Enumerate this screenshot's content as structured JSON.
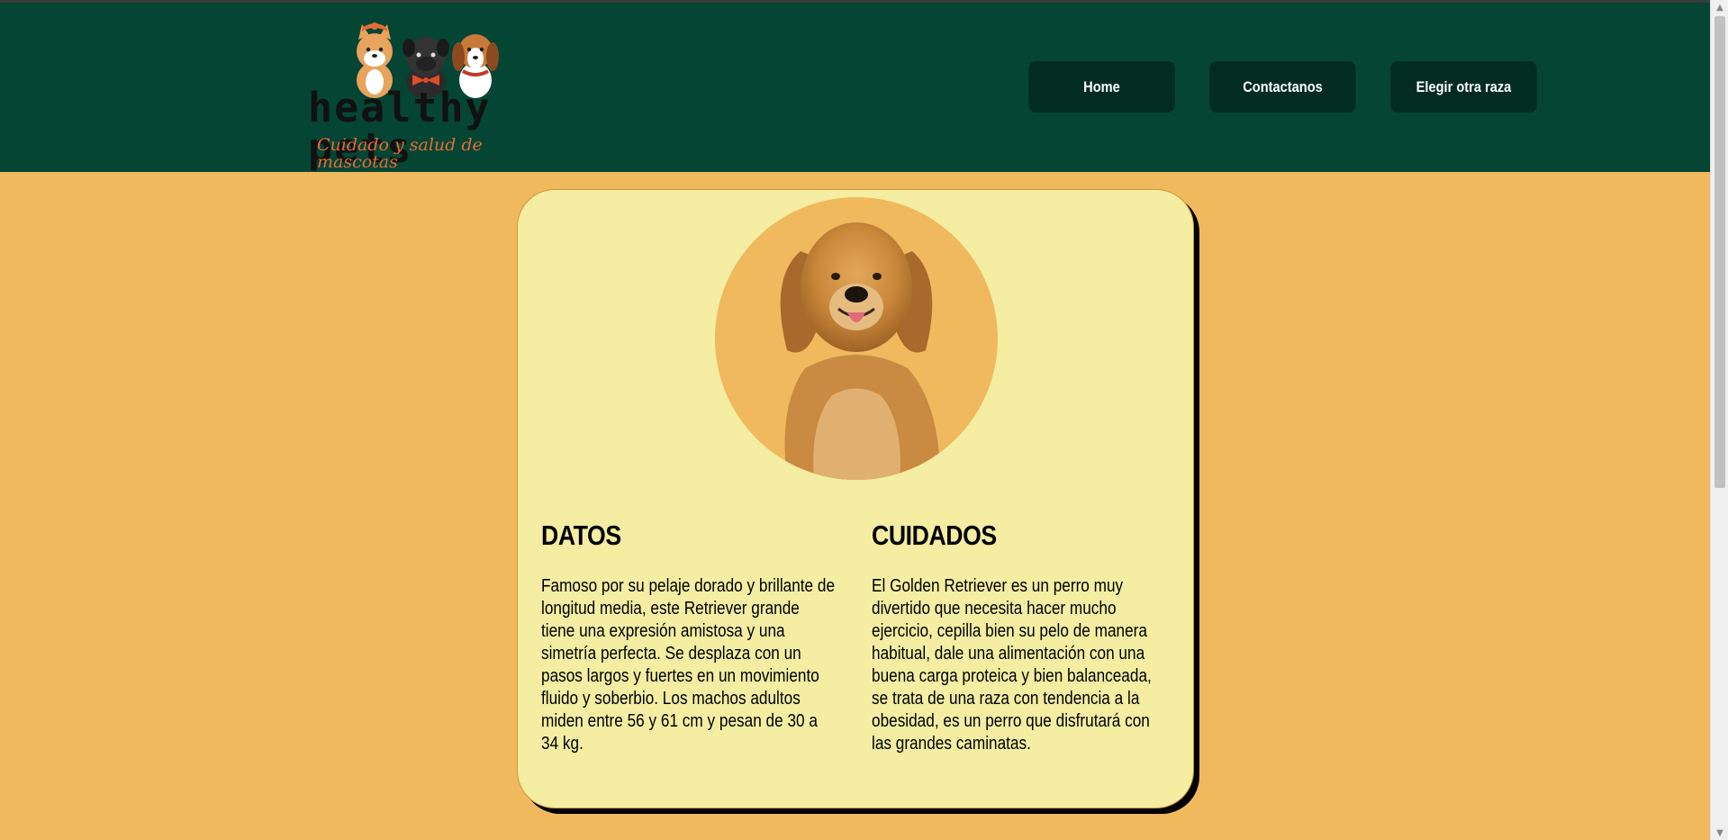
{
  "header": {
    "logo": {
      "title": "healthy pets",
      "subtitle": "Cuidado y salud de mascotas"
    },
    "nav": [
      {
        "label": "Home"
      },
      {
        "label": "Contactanos"
      },
      {
        "label": "Elegir otra raza"
      }
    ]
  },
  "card": {
    "datos": {
      "heading": "DATOS",
      "text": "Famoso por su pelaje dorado y brillante de longitud media, este Retriever grande tiene una expresión amistosa y una simetría perfecta. Se desplaza con un pasos largos y fuertes en un movimiento fluido y soberbio. Los machos adultos miden entre 56 y 61 cm y pesan de 30 a 34 kg."
    },
    "cuidados": {
      "heading": "CUIDADOS",
      "text": "El Golden Retriever es un perro muy divertido que necesita hacer mucho ejercicio, cepilla bien su pelo de manera habitual, dale una alimentación con una buena carga proteica y bien balanceada, se trata de una raza con tendencia a la obesidad, es un perro que disfrutará con las grandes caminatas."
    }
  },
  "colors": {
    "header_bg": "#054534",
    "nav_button_bg": "#022C22",
    "page_bg": "#F0B95E",
    "card_bg": "#F4EDA2",
    "logo_subtitle": "#E46C34"
  },
  "icons": {
    "scroll_up": "▲",
    "scroll_down": "▼"
  }
}
